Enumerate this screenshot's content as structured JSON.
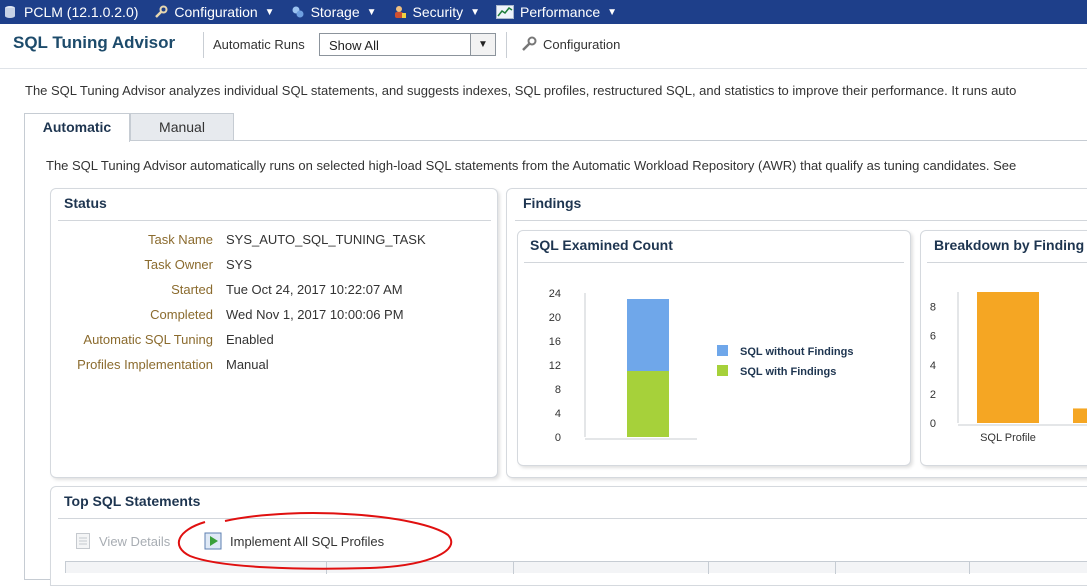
{
  "topbar": {
    "target": "PCLM (12.1.0.2.0)",
    "menus": [
      {
        "label": "Configuration",
        "icon": "wrench-icon"
      },
      {
        "label": "Storage",
        "icon": "storage-icon"
      },
      {
        "label": "Security",
        "icon": "security-icon"
      },
      {
        "label": "Performance",
        "icon": "performance-icon"
      }
    ]
  },
  "header": {
    "title": "SQL Tuning Advisor",
    "runs_label": "Automatic Runs",
    "runs_selected": "Show All",
    "config_label": "Configuration"
  },
  "intro_text": "The SQL Tuning Advisor analyzes individual SQL statements, and suggests indexes, SQL profiles, restructured SQL, and statistics to improve their performance. It runs auto",
  "tabs": [
    {
      "label": "Automatic",
      "active": true
    },
    {
      "label": "Manual",
      "active": false
    }
  ],
  "automatic": {
    "description": "The SQL Tuning Advisor automatically runs on selected high-load SQL statements from the Automatic Workload Repository (AWR) that qualify as tuning candidates. See"
  },
  "status": {
    "title": "Status",
    "fields": [
      {
        "label": "Task Name",
        "value": "SYS_AUTO_SQL_TUNING_TASK"
      },
      {
        "label": "Task Owner",
        "value": "SYS"
      },
      {
        "label": "Started",
        "value": "Tue Oct 24, 2017 10:22:07 AM"
      },
      {
        "label": "Completed",
        "value": "Wed Nov 1, 2017 10:00:06 PM"
      },
      {
        "label": "Automatic SQL Tuning",
        "value": "Enabled"
      },
      {
        "label": "Profiles Implementation",
        "value": "Manual"
      }
    ]
  },
  "findings": {
    "title": "Findings",
    "examined": {
      "title": "SQL Examined Count"
    },
    "breakdown": {
      "title": "Breakdown by Finding"
    }
  },
  "chart_data": [
    {
      "type": "bar",
      "title": "SQL Examined Count",
      "stacked": true,
      "categories": [
        ""
      ],
      "ylim": [
        0,
        24
      ],
      "yticks": [
        "0",
        "4",
        "8",
        "12",
        "16",
        "20",
        "24"
      ],
      "series": [
        {
          "name": "SQL with Findings",
          "values": [
            11
          ],
          "color": "#a6d13a"
        },
        {
          "name": "SQL without Findings",
          "values": [
            12
          ],
          "color": "#6fa7ea"
        }
      ],
      "legend": "right"
    },
    {
      "type": "bar",
      "title": "Breakdown by Finding",
      "categories": [
        "SQL Profile",
        ""
      ],
      "ylim": [
        0,
        9
      ],
      "yticks": [
        "0",
        "2",
        "4",
        "6",
        "8"
      ],
      "series": [
        {
          "name": "",
          "values": [
            9,
            1
          ],
          "color": "#f5a623"
        }
      ]
    }
  ],
  "top_sql": {
    "title": "Top SQL Statements",
    "view_details": "View Details",
    "implement_all": "Implement All SQL Profiles"
  },
  "colors": {
    "topbar": "#1e3f8a",
    "title": "#1e3550",
    "field_label": "#8b6b2e",
    "annotation": "#e01010"
  }
}
